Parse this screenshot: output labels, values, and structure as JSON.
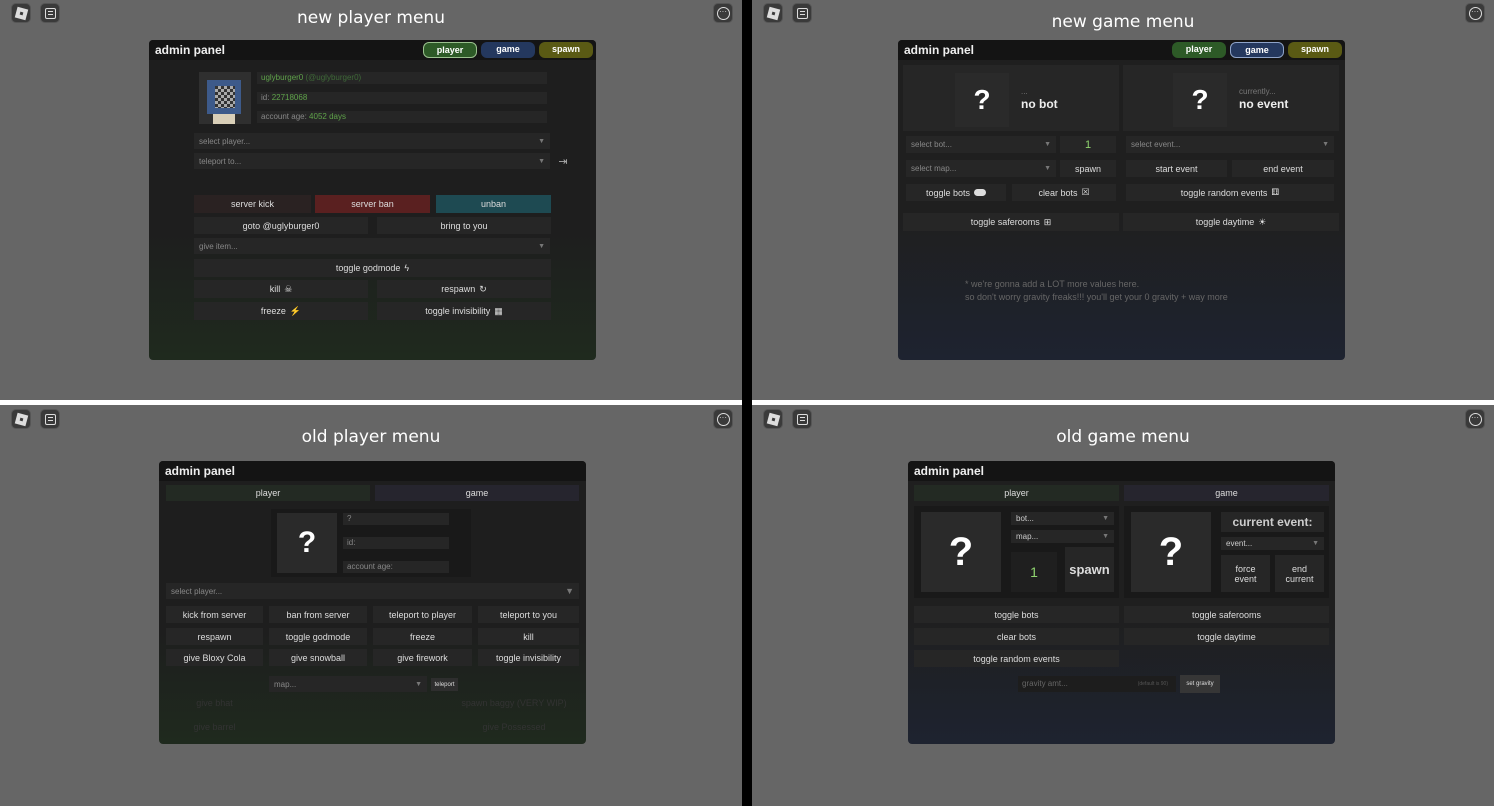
{
  "q1": {
    "title": "new player menu",
    "panel_title": "admin panel",
    "tabs": [
      {
        "label": "player",
        "color": "#2d5a27"
      },
      {
        "label": "game",
        "color": "#24385e"
      },
      {
        "label": "spawn",
        "color": "#5a5a14"
      }
    ],
    "username": "uglyburger0",
    "handle": "(@uglyburger0)",
    "id_label": "id:",
    "id_value": "22718068",
    "age_label": "account age:",
    "age_value": "4052 days",
    "select_player": "select player...",
    "teleport_to": "teleport to...",
    "server_kick": "server kick",
    "server_ban": "server ban",
    "unban": "unban",
    "goto": "goto @uglyburger0",
    "bring": "bring to you",
    "give_item": "give item...",
    "toggle_godmode": "toggle godmode",
    "kill": "kill",
    "respawn": "respawn",
    "freeze": "freeze",
    "toggle_invisibility": "toggle invisibility"
  },
  "q2": {
    "title": "new game menu",
    "panel_title": "admin panel",
    "tabs": [
      {
        "label": "player",
        "color": "#2d5a27"
      },
      {
        "label": "game",
        "color": "#24385e"
      },
      {
        "label": "spawn",
        "color": "#5a5a14"
      }
    ],
    "qmark": "?",
    "bot_ellipsis": "...",
    "no_bot": "no bot",
    "currently": "currently...",
    "no_event": "no event",
    "select_bot": "select bot...",
    "bot_count": "1",
    "select_event": "select event...",
    "select_map": "select map...",
    "spawn": "spawn",
    "start_event": "start event",
    "end_event": "end event",
    "toggle_bots": "toggle bots",
    "clear_bots": "clear bots",
    "toggle_random_events": "toggle random events",
    "toggle_saferooms": "toggle saferooms",
    "toggle_daytime": "toggle daytime",
    "note_line1": "* we're gonna add a LOT more values here.",
    "note_line2": "so don't worry gravity freaks!!! you'll get your 0 gravity + way more"
  },
  "q3": {
    "title": "old player menu",
    "panel_title": "admin panel",
    "tab_player": "player",
    "tab_game": "game",
    "qmark": "?",
    "name_field": "?",
    "id_field": "id:",
    "age_field": "account age:",
    "select_player": "select player...",
    "buttons": [
      "kick from server",
      "ban from server",
      "teleport to player",
      "teleport to you",
      "respawn",
      "toggle godmode",
      "freeze",
      "kill",
      "give Bloxy Cola",
      "give snowball",
      "give firework",
      "toggle invisibility"
    ],
    "map": "map...",
    "teleport": "teleport",
    "faded": [
      "give bhat",
      "spawn baggy (VERY WIP)",
      "give barrel",
      "give Possessed"
    ]
  },
  "q4": {
    "title": "old game menu",
    "panel_title": "admin panel",
    "tab_player": "player",
    "tab_game": "game",
    "qmark": "?",
    "bot_dd": "bot...",
    "map_dd": "map...",
    "count": "1",
    "spawn": "spawn",
    "current_event": "current event:",
    "event_dd": "event...",
    "force_event_1": "force",
    "force_event_2": "event",
    "end_current_1": "end",
    "end_current_2": "current",
    "toggle_bots": "toggle bots",
    "toggle_saferooms": "toggle saferooms",
    "clear_bots": "clear bots",
    "toggle_daytime": "toggle daytime",
    "toggle_random_events": "toggle random events",
    "gravity_placeholder": "gravity amt...",
    "gravity_default": "(default is 90)",
    "set_gravity": "set gravity"
  }
}
